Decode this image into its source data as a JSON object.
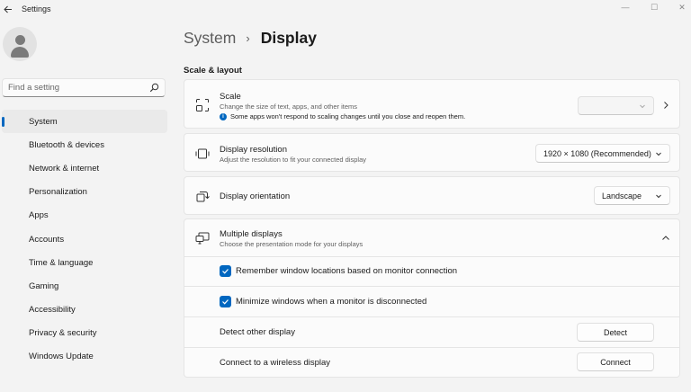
{
  "window": {
    "app_title": "Settings",
    "back_icon": "back-arrow-icon",
    "minimize_glyph": "—",
    "maximize_glyph": "☐",
    "close_glyph": "✕"
  },
  "sidebar": {
    "search_placeholder": "Find a setting",
    "items": [
      {
        "label": "System",
        "active": true
      },
      {
        "label": "Bluetooth & devices"
      },
      {
        "label": "Network & internet"
      },
      {
        "label": "Personalization"
      },
      {
        "label": "Apps"
      },
      {
        "label": "Accounts"
      },
      {
        "label": "Time & language"
      },
      {
        "label": "Gaming"
      },
      {
        "label": "Accessibility"
      },
      {
        "label": "Privacy & security"
      },
      {
        "label": "Windows Update"
      }
    ]
  },
  "header": {
    "parent": "System",
    "separator": "›",
    "current": "Display"
  },
  "section": {
    "title": "Scale & layout"
  },
  "scale": {
    "title": "Scale",
    "desc": "Change the size of text, apps, and other items",
    "warning": "Some apps won't respond to scaling changes until you close and reopen them.",
    "info_glyph": "i",
    "value": ""
  },
  "resolution": {
    "title": "Display resolution",
    "desc": "Adjust the resolution to fit your connected display",
    "value": "1920 × 1080 (Recommended)"
  },
  "orientation": {
    "title": "Display orientation",
    "value": "Landscape"
  },
  "multiple": {
    "title": "Multiple displays",
    "desc": "Choose the presentation mode for your displays",
    "remember_label": "Remember window locations based on monitor connection",
    "remember_checked": true,
    "minimize_label": "Minimize windows when a monitor is disconnected",
    "minimize_checked": true,
    "detect_label": "Detect other display",
    "detect_button": "Detect",
    "wireless_label": "Connect to a wireless display",
    "connect_button": "Connect"
  },
  "colors": {
    "accent": "#0067c0",
    "background": "#f3f3f3",
    "card": "#fbfbfb"
  }
}
